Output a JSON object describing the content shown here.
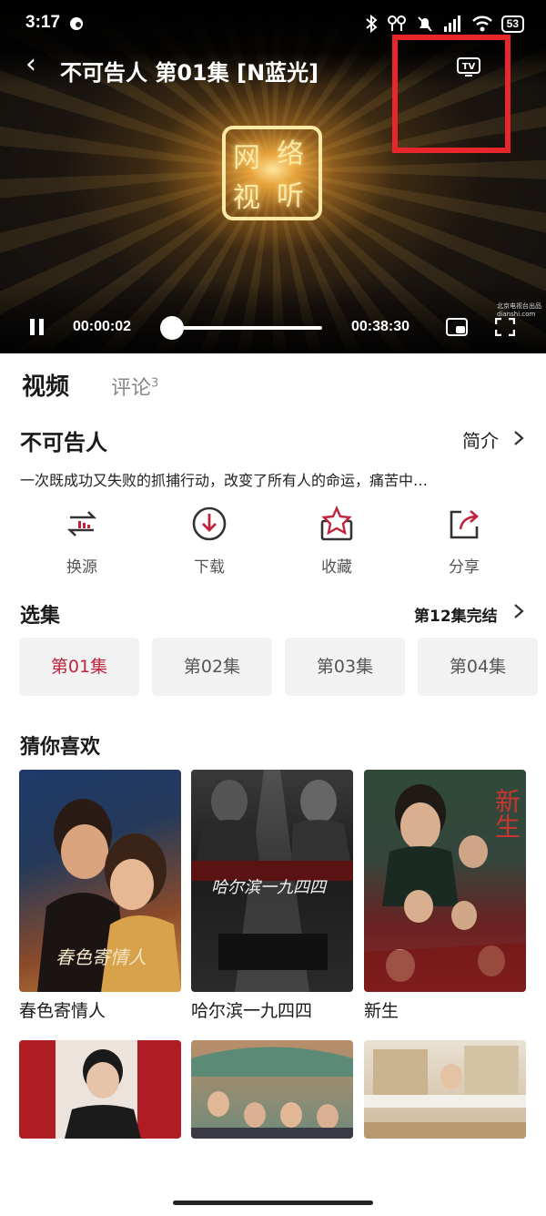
{
  "status_bar": {
    "time": "3:17",
    "battery": "53",
    "icons": [
      "chat-bubble-icon",
      "bluetooth-icon",
      "earbuds-icon",
      "alarm-off-icon",
      "signal-icon",
      "wifi-icon",
      "battery-icon"
    ]
  },
  "player": {
    "title": "不可告人 第01集 [N蓝光]",
    "tv_label": "TV",
    "current_time": "00:00:02",
    "total_time": "00:38:30",
    "progress": 0.0009,
    "logo_chars": [
      "网",
      "络",
      "视",
      "听"
    ],
    "watermark": "北京电视台出品\ndianshi.com"
  },
  "tabs": {
    "video": "视频",
    "comments": "评论",
    "comment_count": "3"
  },
  "show": {
    "title": "不可告人",
    "intro_link": "简介",
    "synopsis": "一次既成功又失败的抓捕行动，改变了所有人的命运，痛苦中…"
  },
  "actions": [
    {
      "label": "换源",
      "icon": "switch-source-icon"
    },
    {
      "label": "下载",
      "icon": "download-icon"
    },
    {
      "label": "收藏",
      "icon": "favorite-star-icon"
    },
    {
      "label": "分享",
      "icon": "share-icon"
    }
  ],
  "episodes": {
    "title": "选集",
    "total": "第12集完结",
    "items": [
      "第01集",
      "第02集",
      "第03集",
      "第04集"
    ],
    "active_index": 0
  },
  "recommend": {
    "title": "猜你喜欢",
    "posters": [
      {
        "title": "春色寄情人",
        "art": "春色寄情人"
      },
      {
        "title": "哈尔滨一九四四",
        "art": "哈尔滨一九四四"
      },
      {
        "title": "新生",
        "art": "新生"
      },
      {
        "title": ""
      },
      {
        "title": ""
      },
      {
        "title": ""
      }
    ]
  },
  "colors": {
    "accent_red": "#c0233c",
    "highlight_box": "#e8262c"
  }
}
